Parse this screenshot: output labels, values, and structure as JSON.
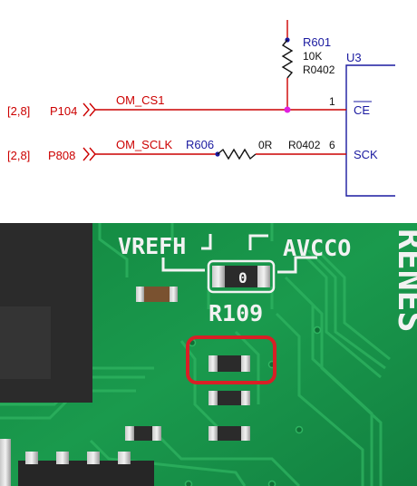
{
  "schematic": {
    "resistor_r601": {
      "ref": "R601",
      "value": "10K",
      "package": "R0402"
    },
    "chip": {
      "ref": "U3",
      "pin1_number": "1",
      "pin1_name": "CE",
      "pin6_number": "6",
      "pin6_name": "SCK"
    },
    "net_cs": {
      "sheet_ref": "[2,8]",
      "port": "P104",
      "net": "OM_CS1"
    },
    "net_sclk": {
      "sheet_ref": "[2,8]",
      "port": "P808",
      "net": "OM_SCLK"
    },
    "resistor_r606": {
      "ref": "R606",
      "value": "0R",
      "package": "R0402"
    }
  },
  "photo": {
    "silkscreen_left": "VREFH",
    "silkscreen_right": "AVCCO",
    "resistor_label": "R109",
    "resistor_marking": "0",
    "brand_fragment": "RENES",
    "highlight_color": "#d81f26",
    "board_color": "#17934a"
  }
}
